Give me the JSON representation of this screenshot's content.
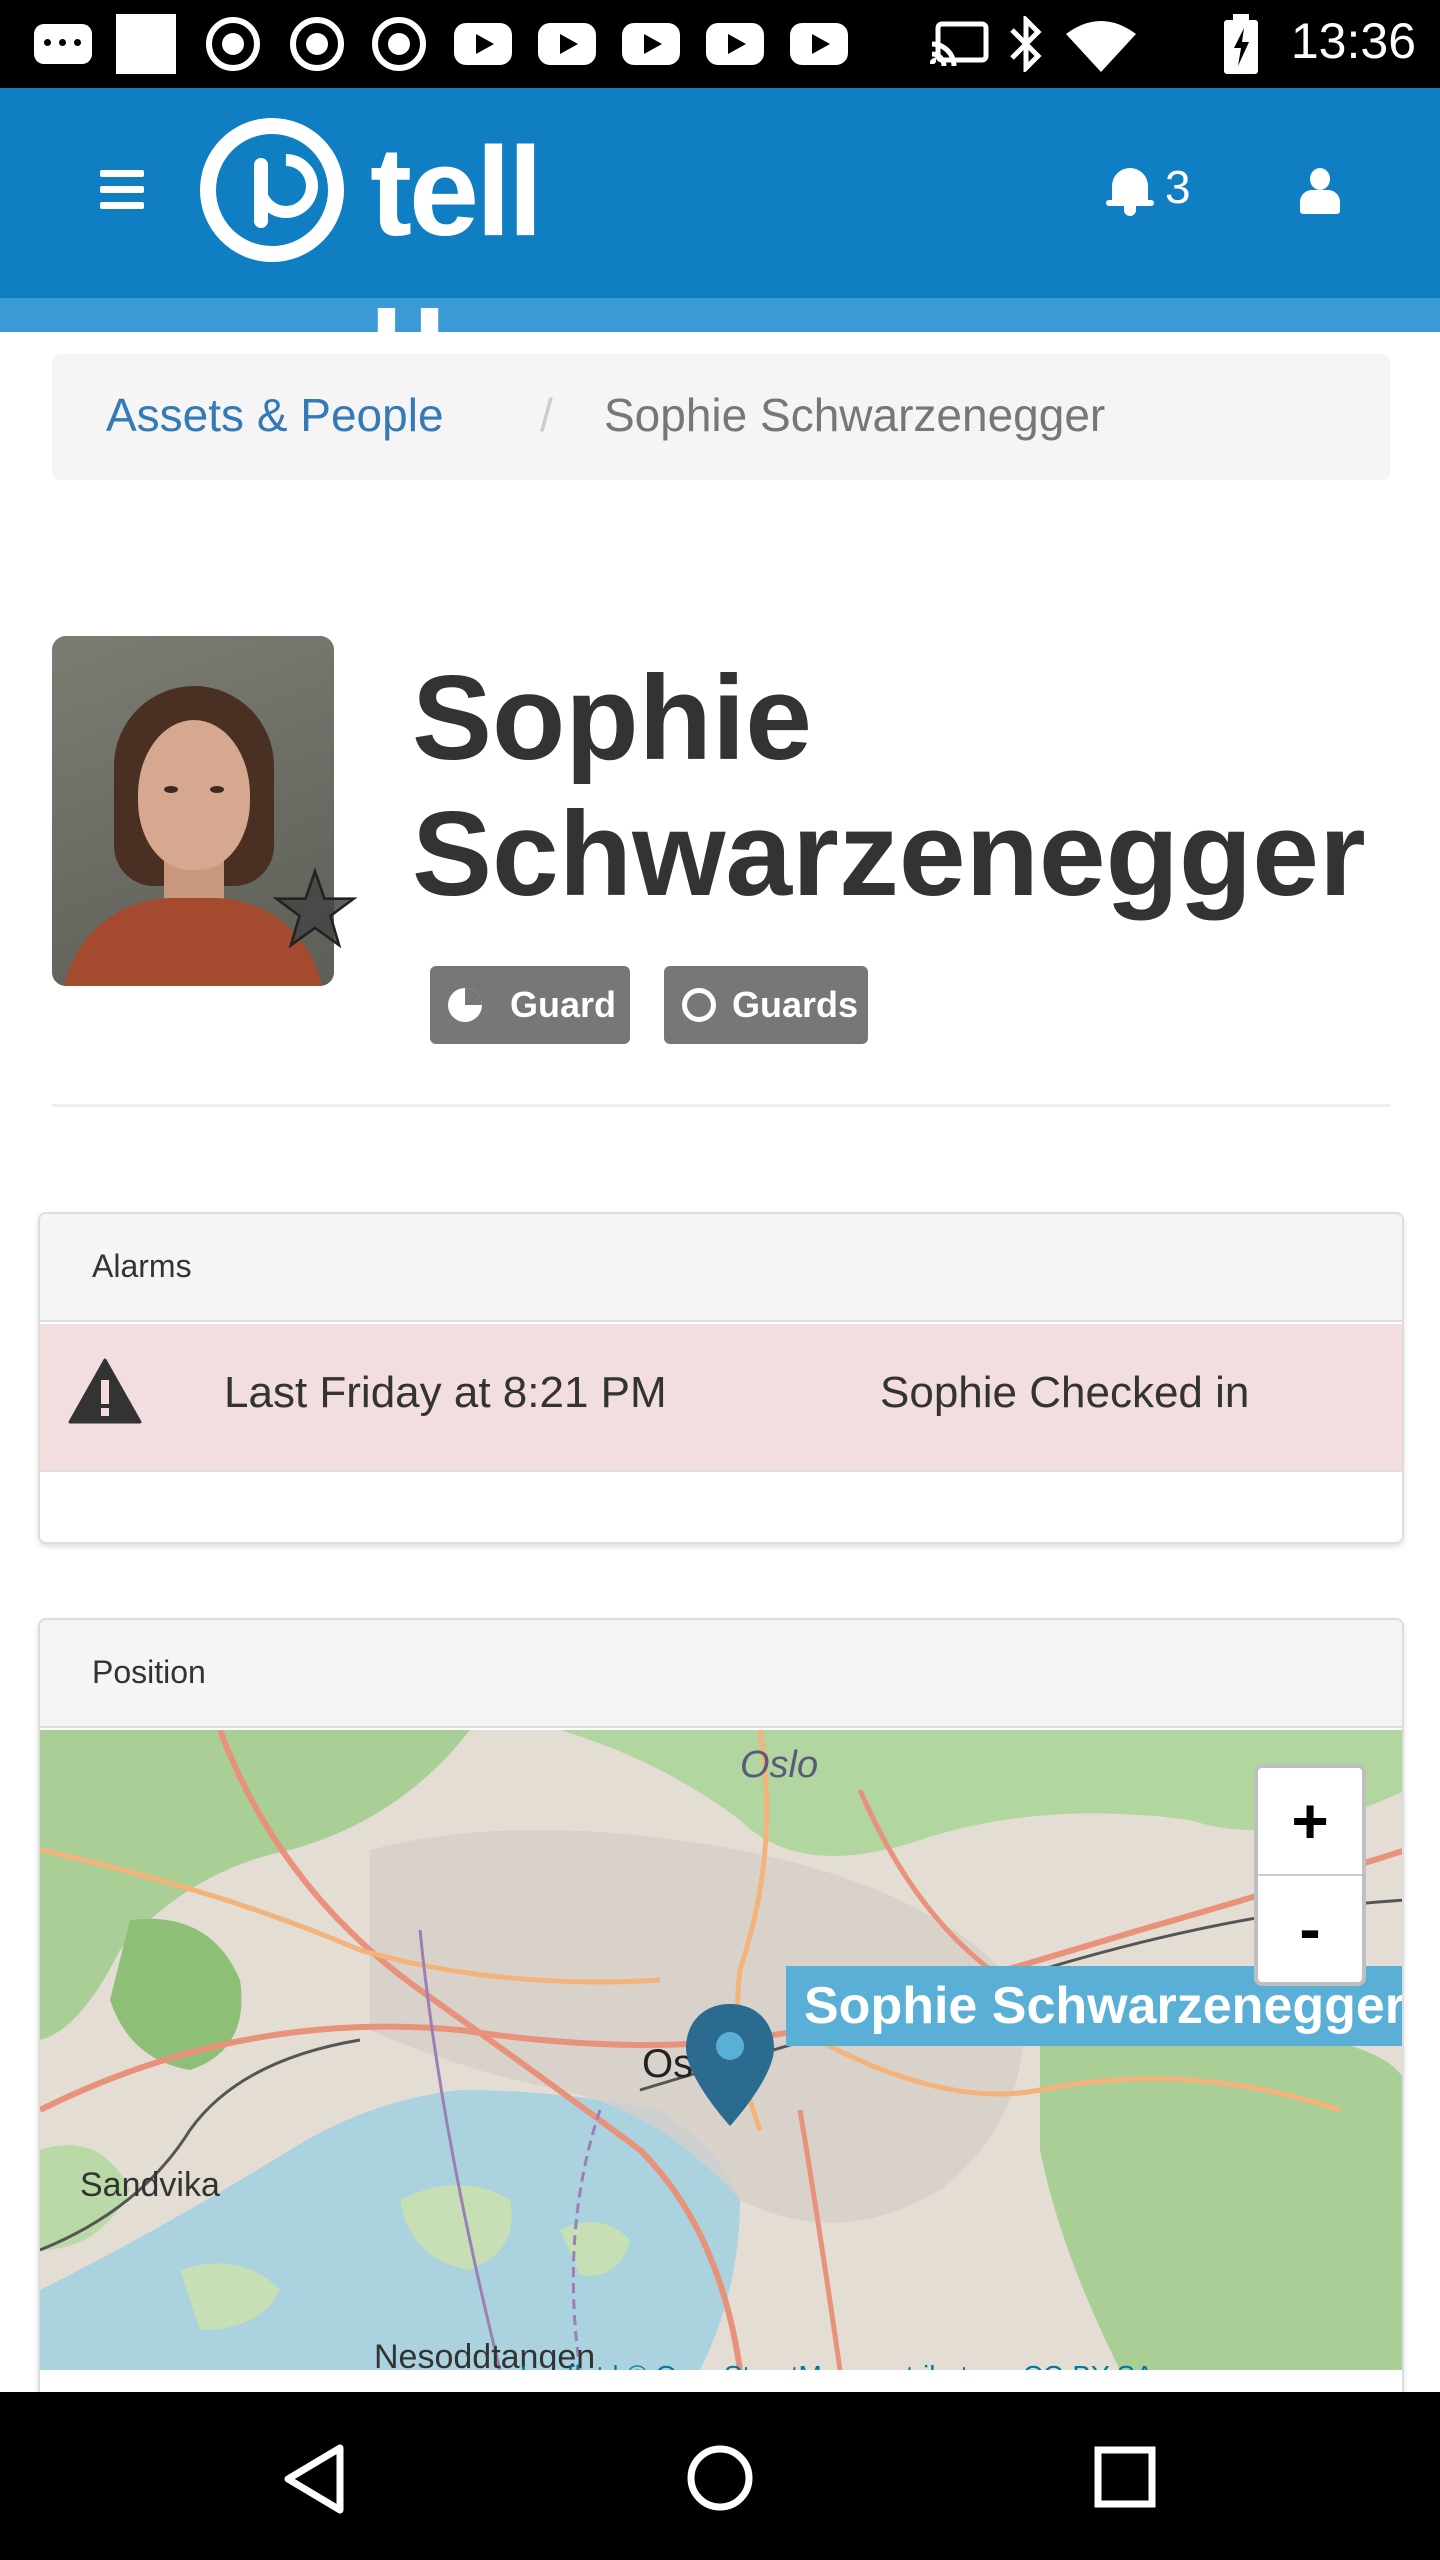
{
  "status_bar": {
    "time": "13:36",
    "icons": [
      "message-icon",
      "square-icon",
      "aperture-icon",
      "aperture-icon",
      "aperture-icon",
      "youtube-icon",
      "youtube-icon",
      "youtube-icon",
      "youtube-icon",
      "youtube-icon",
      "cast-icon",
      "bluetooth-icon",
      "wifi-icon",
      "battery-icon"
    ]
  },
  "header": {
    "brand": "tell u",
    "notification_count": "3",
    "icons": [
      "menu-icon",
      "bell-icon",
      "user-icon"
    ],
    "color": "#0f7ec2"
  },
  "breadcrumb": {
    "link": "Assets & People",
    "separator": "/",
    "current": "Sophie Schwarzenegger"
  },
  "profile": {
    "name": "Sophie Schwarzenegger",
    "labels": [
      {
        "text": "Guard",
        "icon": "pie-chart-icon"
      },
      {
        "text": "Guards",
        "icon": "circle-icon"
      }
    ],
    "favorite_icon": "star-icon"
  },
  "alarms": {
    "title": "Alarms",
    "rows": [
      {
        "time": "Last Friday at 8:21 PM",
        "message": "Sophie Checked in",
        "icon": "warning-icon"
      }
    ],
    "row_color": "#f2dede"
  },
  "position": {
    "title": "Position",
    "zoom_in": "+",
    "zoom_out": "-",
    "marker_label": "Sophie Schwarzenegger",
    "places": [
      "Oslo",
      "Os",
      "Sandvika",
      "Nesoddtangen"
    ],
    "attribution": "Leaflet | © OpenStreetMap contributors, CC-BY-SA"
  },
  "android_nav": {
    "icons": [
      "back-icon",
      "home-icon",
      "recents-icon"
    ]
  }
}
